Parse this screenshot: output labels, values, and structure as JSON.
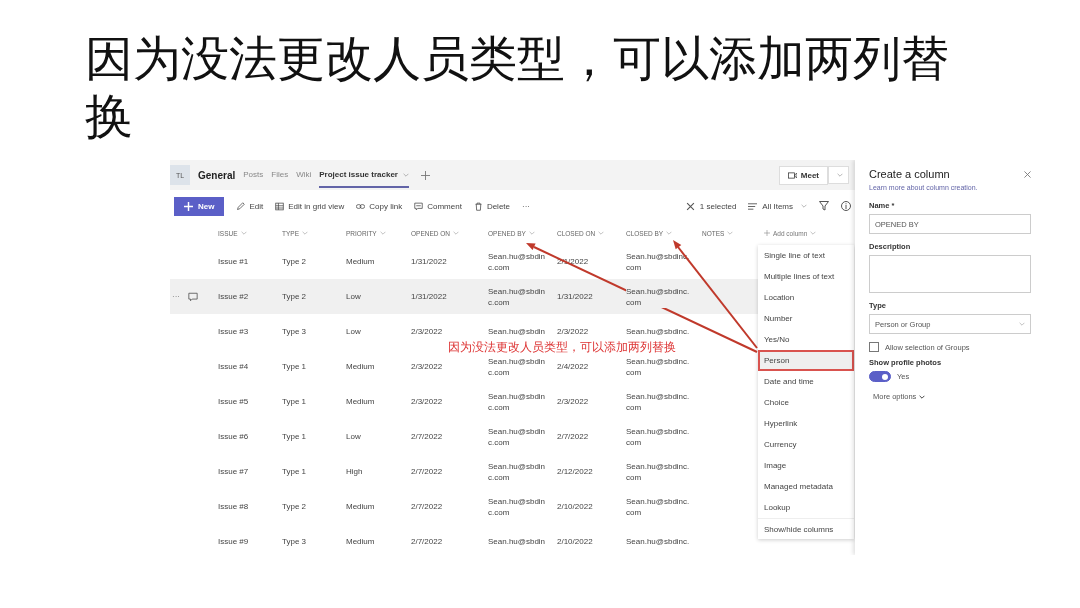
{
  "slide_title": "因为没法更改人员类型，可以添加两列替换",
  "teams": {
    "avatar": "TL",
    "channel": "General",
    "tabs": [
      {
        "label": "Posts",
        "selected": false
      },
      {
        "label": "Files",
        "selected": false
      },
      {
        "label": "Wiki",
        "selected": false
      },
      {
        "label": "Project issue tracker",
        "selected": true
      }
    ],
    "meet": "Meet"
  },
  "toolbar": {
    "new": "New",
    "actions": [
      {
        "kind": "edit",
        "label": "Edit"
      },
      {
        "kind": "grid",
        "label": "Edit in grid view"
      },
      {
        "kind": "link",
        "label": "Copy link"
      },
      {
        "kind": "comment",
        "label": "Comment"
      },
      {
        "kind": "delete",
        "label": "Delete"
      }
    ],
    "more": "···",
    "selected_count": "1 selected",
    "view": "All Items"
  },
  "columns": [
    "ISSUE",
    "TYPE",
    "PRIORITY",
    "OPENED ON",
    "OPENED BY",
    "CLOSED ON",
    "CLOSED BY",
    "NOTES"
  ],
  "add_column": "Add column",
  "row_more": "···",
  "rows": [
    {
      "selected": false,
      "cells": [
        "Issue #1",
        "Type 2",
        "Medium",
        "1/31/2022",
        "Sean.hu@sbdinc.com",
        "2/1/2022",
        "Sean.hu@sbdinc.com"
      ]
    },
    {
      "selected": true,
      "cells": [
        "Issue #2",
        "Type 2",
        "Low",
        "1/31/2022",
        "Sean.hu@sbdinc.com",
        "1/31/2022",
        "Sean.hu@sbdinc.com"
      ]
    },
    {
      "selected": false,
      "cells": [
        "Issue #3",
        "Type 3",
        "Low",
        "2/3/2022",
        "Sean.hu@sbdin",
        "2/3/2022",
        "Sean.hu@sbdinc."
      ]
    },
    {
      "selected": false,
      "cells": [
        "Issue #4",
        "Type 1",
        "Medium",
        "2/3/2022",
        "Sean.hu@sbdinc.com",
        "2/4/2022",
        "Sean.hu@sbdinc.com"
      ]
    },
    {
      "selected": false,
      "cells": [
        "Issue #5",
        "Type 1",
        "Medium",
        "2/3/2022",
        "Sean.hu@sbdinc.com",
        "2/3/2022",
        "Sean.hu@sbdinc.com"
      ]
    },
    {
      "selected": false,
      "cells": [
        "Issue #6",
        "Type 1",
        "Low",
        "2/7/2022",
        "Sean.hu@sbdinc.com",
        "2/7/2022",
        "Sean.hu@sbdinc.com"
      ]
    },
    {
      "selected": false,
      "cells": [
        "Issue #7",
        "Type 1",
        "High",
        "2/7/2022",
        "Sean.hu@sbdinc.com",
        "2/12/2022",
        "Sean.hu@sbdinc.com"
      ]
    },
    {
      "selected": false,
      "cells": [
        "Issue #8",
        "Type 2",
        "Medium",
        "2/7/2022",
        "Sean.hu@sbdinc.com",
        "2/10/2022",
        "Sean.hu@sbdinc.com"
      ]
    },
    {
      "selected": false,
      "cells": [
        "Issue #9",
        "Type 3",
        "Medium",
        "2/7/2022",
        "Sean.hu@sbdin",
        "2/10/2022",
        "Sean.hu@sbdinc."
      ]
    }
  ],
  "menu": [
    {
      "label": "Single line of text",
      "selected": false
    },
    {
      "label": "Multiple lines of text",
      "selected": false
    },
    {
      "label": "Location",
      "selected": false
    },
    {
      "label": "Number",
      "selected": false
    },
    {
      "label": "Yes/No",
      "selected": false
    },
    {
      "label": "Person",
      "selected": true
    },
    {
      "label": "Date and time",
      "selected": false
    },
    {
      "label": "Choice",
      "selected": false
    },
    {
      "label": "Hyperlink",
      "selected": false
    },
    {
      "label": "Currency",
      "selected": false
    },
    {
      "label": "Image",
      "selected": false
    },
    {
      "label": "Managed metadata",
      "selected": false
    },
    {
      "label": "Lookup",
      "selected": false
    },
    {
      "label": "Show/hide columns",
      "selected": false
    }
  ],
  "panel": {
    "title": "Create a column",
    "link": "Learn more about column creation.",
    "name_label": "Name *",
    "name_value": "OPENED BY",
    "description_label": "Description",
    "type_label": "Type",
    "type_value": "Person or Group",
    "group_checkbox": {
      "label": "Allow selection of Groups",
      "checked": false
    },
    "photos": {
      "label": "Show profile photos",
      "on": true,
      "state_text": "Yes"
    },
    "more_options": "More options"
  },
  "annotation": "因为没法更改人员类型，可以添加两列替换"
}
